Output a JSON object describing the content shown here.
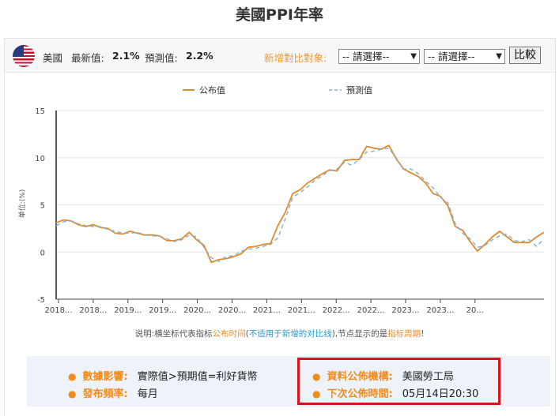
{
  "title": "美國PPI年率",
  "header": {
    "country": "美國",
    "latest_label": "最新值:",
    "latest_value": "2.1%",
    "forecast_label": "預測值:",
    "forecast_value": "2.2%",
    "compare_label": "新增對比對象:",
    "select1": "-- 請選擇--",
    "select2": "-- 請選擇--",
    "compare_button": "比較"
  },
  "note": {
    "p1": "说明:横坐标代表指标",
    "p2": "公布时间",
    "p3": "(",
    "p4": "不适用于新增的对比线",
    "p5": "),节点显示的是",
    "p6": "指标周期",
    "p7": "!"
  },
  "info": {
    "impact_label": "數據影響:",
    "impact_value": "實際值>預期值=利好貨幣",
    "freq_label": "發布頻率:",
    "freq_value": "每月",
    "source_label": "資料公佈機構:",
    "source_value": "美國勞工局",
    "next_label": "下次公佈時間:",
    "next_value": "05月14日20:30"
  },
  "colors": {
    "actual": "#e08a2c",
    "forecast": "#7fb0d8",
    "accent": "#f08c1e",
    "highlight": "#d4141c"
  },
  "chart_data": {
    "type": "line",
    "ylabel": "单位:(%)",
    "ylim": [
      -5,
      15
    ],
    "yticks": [
      "15",
      "10",
      "5",
      "0",
      "-5"
    ],
    "xtick_labels": [
      "2018...",
      "2018...",
      "2019...",
      "2019...",
      "2020...",
      "2020...",
      "2021...",
      "2021...",
      "2022...",
      "2022...",
      "2023...",
      "2023...",
      "20..."
    ],
    "legend": [
      "公布值",
      "預測值"
    ],
    "legend_position": "top",
    "series": [
      {
        "name": "公布值",
        "style": "solid",
        "values": [
          3.1,
          3.4,
          3.3,
          2.9,
          2.7,
          2.9,
          2.6,
          2.5,
          2.0,
          1.9,
          2.2,
          2.0,
          1.8,
          1.8,
          1.7,
          1.2,
          1.2,
          1.4,
          2.1,
          1.3,
          0.7,
          -1.1,
          -0.8,
          -0.7,
          -0.5,
          -0.2,
          0.5,
          0.6,
          0.8,
          0.9,
          2.8,
          4.2,
          6.2,
          6.6,
          7.3,
          7.8,
          8.3,
          8.7,
          8.6,
          9.7,
          9.8,
          9.8,
          11.2,
          11.0,
          10.9,
          11.3,
          9.9,
          8.8,
          8.4,
          8.0,
          7.3,
          6.2,
          5.9,
          4.9,
          2.7,
          2.3,
          1.1,
          0.1,
          0.8,
          1.6,
          2.2,
          1.6,
          1.0,
          1.0,
          1.0,
          1.6,
          2.1
        ]
      },
      {
        "name": "預測值",
        "style": "dashed",
        "values": [
          2.8,
          3.2,
          3.3,
          3.0,
          2.8,
          2.7,
          2.7,
          2.4,
          2.2,
          2.0,
          2.0,
          2.1,
          1.8,
          1.7,
          1.7,
          1.4,
          1.1,
          1.3,
          1.8,
          1.6,
          0.5,
          -0.6,
          -1.0,
          -0.5,
          -0.4,
          0.1,
          0.3,
          0.4,
          0.6,
          0.8,
          1.5,
          3.5,
          5.8,
          6.3,
          6.9,
          7.6,
          8.1,
          8.6,
          8.8,
          9.5,
          9.2,
          9.8,
          10.6,
          10.7,
          10.9,
          11.0,
          10.0,
          8.8,
          8.8,
          8.3,
          7.5,
          6.8,
          5.8,
          5.2,
          3.0,
          2.0,
          1.4,
          0.5,
          0.7,
          1.3,
          1.7,
          1.9,
          1.2,
          1.1,
          1.3,
          0.6,
          1.4
        ]
      }
    ]
  }
}
